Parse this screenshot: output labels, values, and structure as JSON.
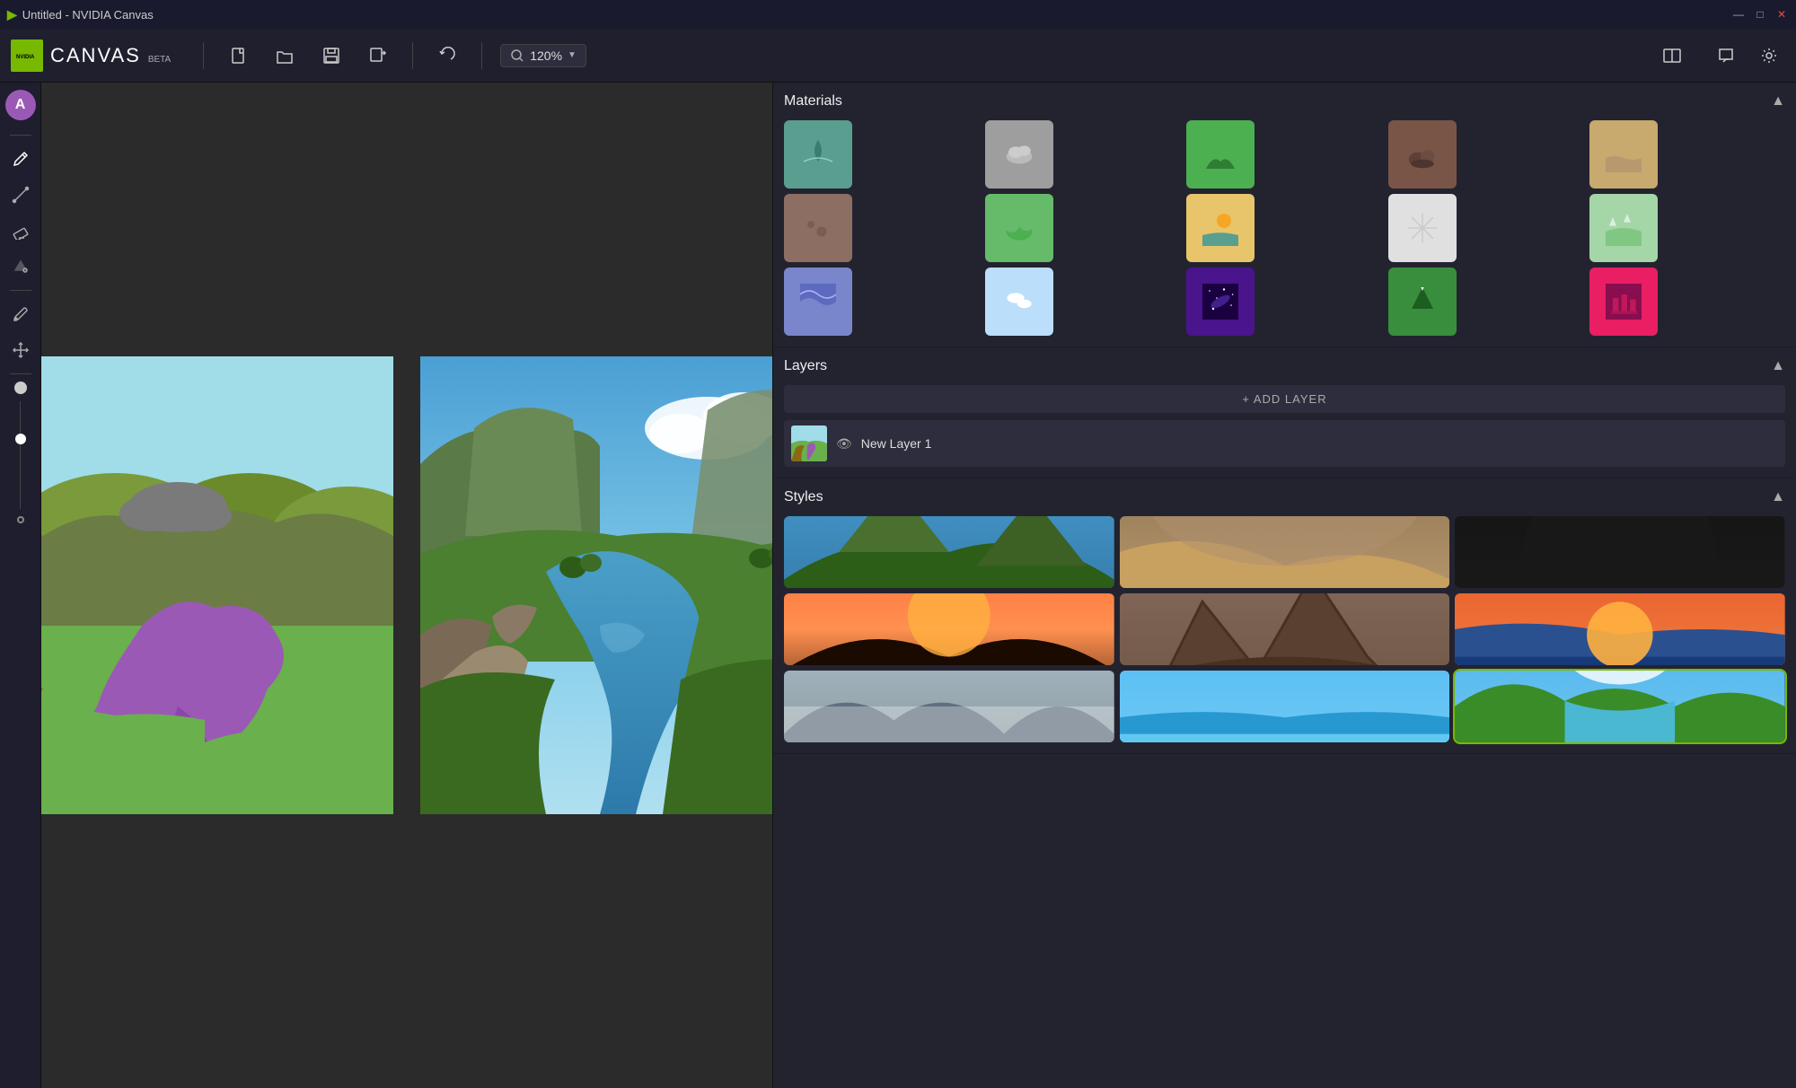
{
  "window": {
    "title": "Untitled - NVIDIA Canvas"
  },
  "titlebar": {
    "title": "Untitled - NVIDIA Canvas",
    "controls": {
      "minimize": "—",
      "maximize": "□",
      "close": "✕"
    }
  },
  "toolbar": {
    "logo": "NVIDIA",
    "app_name": "CANVAS",
    "app_beta": "BETA",
    "buttons": {
      "new": "new-file",
      "open": "open-file",
      "save": "save-file",
      "export": "export-file",
      "undo": "undo"
    },
    "zoom": {
      "value": "120%",
      "label": "120%"
    },
    "split_view": "split-view",
    "feedback": "feedback",
    "settings": "settings"
  },
  "left_sidebar": {
    "tools": [
      {
        "name": "paintbrush",
        "label": "Paintbrush",
        "active": true
      },
      {
        "name": "line",
        "label": "Line"
      },
      {
        "name": "eraser",
        "label": "Eraser"
      },
      {
        "name": "fill",
        "label": "Fill"
      },
      {
        "name": "eyedropper",
        "label": "Eyedropper"
      },
      {
        "name": "pan",
        "label": "Pan"
      }
    ]
  },
  "materials": {
    "title": "Materials",
    "items": [
      {
        "id": "water",
        "color": "#5a9e8f",
        "icon": "🌊",
        "label": "Water"
      },
      {
        "id": "cloud",
        "color": "#9e9e9e",
        "icon": "☁️",
        "label": "Cloud"
      },
      {
        "id": "grass",
        "color": "#4caf50",
        "icon": "🌿",
        "label": "Grass"
      },
      {
        "id": "rocks",
        "color": "#795548",
        "icon": "🪨",
        "label": "Rocks"
      },
      {
        "id": "sand",
        "color": "#c8a96e",
        "icon": "🏜️",
        "label": "Sand"
      },
      {
        "id": "dirt",
        "color": "#8d6e63",
        "icon": "🟤",
        "label": "Dirt"
      },
      {
        "id": "shrub",
        "color": "#66bb6a",
        "icon": "🌱",
        "label": "Shrub"
      },
      {
        "id": "beach",
        "color": "#e8c56a",
        "icon": "🏖️",
        "label": "Beach"
      },
      {
        "id": "snow",
        "color": "#e0e0e0",
        "icon": "❄️",
        "label": "Snow"
      },
      {
        "id": "tundra",
        "color": "#a5d6a7",
        "icon": "🌨️",
        "label": "Tundra"
      },
      {
        "id": "ocean_wave",
        "color": "#7986cb",
        "icon": "🌊",
        "label": "Ocean Wave"
      },
      {
        "id": "sky",
        "color": "#bbdefb",
        "icon": "🔵",
        "label": "Sky"
      },
      {
        "id": "galaxy",
        "color": "#4a148c",
        "icon": "✨",
        "label": "Galaxy"
      },
      {
        "id": "mountain",
        "color": "#388e3c",
        "icon": "⛰️",
        "label": "Mountain"
      },
      {
        "id": "ruin",
        "color": "#e91e63",
        "icon": "🏛️",
        "label": "Ruin"
      }
    ]
  },
  "layers": {
    "title": "Layers",
    "add_label": "+ ADD LAYER",
    "items": [
      {
        "id": "layer1",
        "name": "New Layer 1",
        "visible": true,
        "thumb_colors": [
          "#6ab04c",
          "#9b59b6",
          "#8b6914"
        ]
      }
    ]
  },
  "styles": {
    "title": "Styles",
    "items": [
      {
        "id": "s1",
        "label": "Mountain Valley",
        "active": false
      },
      {
        "id": "s2",
        "label": "Desert Storm",
        "active": false
      },
      {
        "id": "s3",
        "label": "Dark Cave",
        "active": false
      },
      {
        "id": "s4",
        "label": "Sunset Mountains",
        "active": false
      },
      {
        "id": "s5",
        "label": "Rocky Formation",
        "active": false
      },
      {
        "id": "s6",
        "label": "Ocean Sunset",
        "active": false
      },
      {
        "id": "s7",
        "label": "Misty Mountains",
        "active": false
      },
      {
        "id": "s8",
        "label": "Tropical Beach",
        "active": false
      },
      {
        "id": "s9",
        "label": "Green Valley",
        "active": true
      }
    ]
  }
}
